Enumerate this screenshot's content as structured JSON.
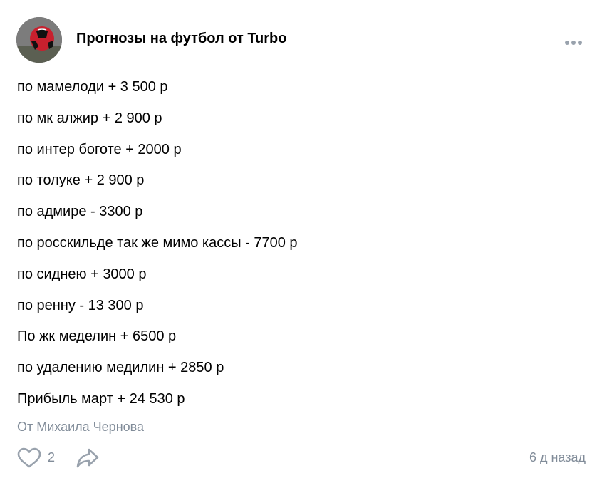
{
  "post": {
    "author": "Прогнозы на футбол от Turbo",
    "avatar_icon": "soccer-ball-avatar",
    "more_icon": "more-horizontal-icon",
    "lines": [
      "по мамелоди + 3 500 р",
      "по мк алжир + 2 900 р",
      "по интер боготе + 2000 р",
      "по толуке + 2 900 р",
      "по адмире - 3300 р",
      "по росскильде так же мимо кассы - 7700 р",
      "по сиднею + 3000 р",
      "по ренну - 13 300 р",
      "По жк меделин + 6500 р",
      "по удалению медилин + 2850 р",
      "Прибыль март + 24 530 р"
    ],
    "signature": "От Михаила Чернова",
    "likes": "2",
    "like_icon": "heart-outline-icon",
    "share_icon": "share-arrow-icon",
    "time": "6 д назад"
  },
  "colors": {
    "text": "#000000",
    "muted": "#818c99",
    "icon": "#99a2ad",
    "background": "#ffffff"
  }
}
